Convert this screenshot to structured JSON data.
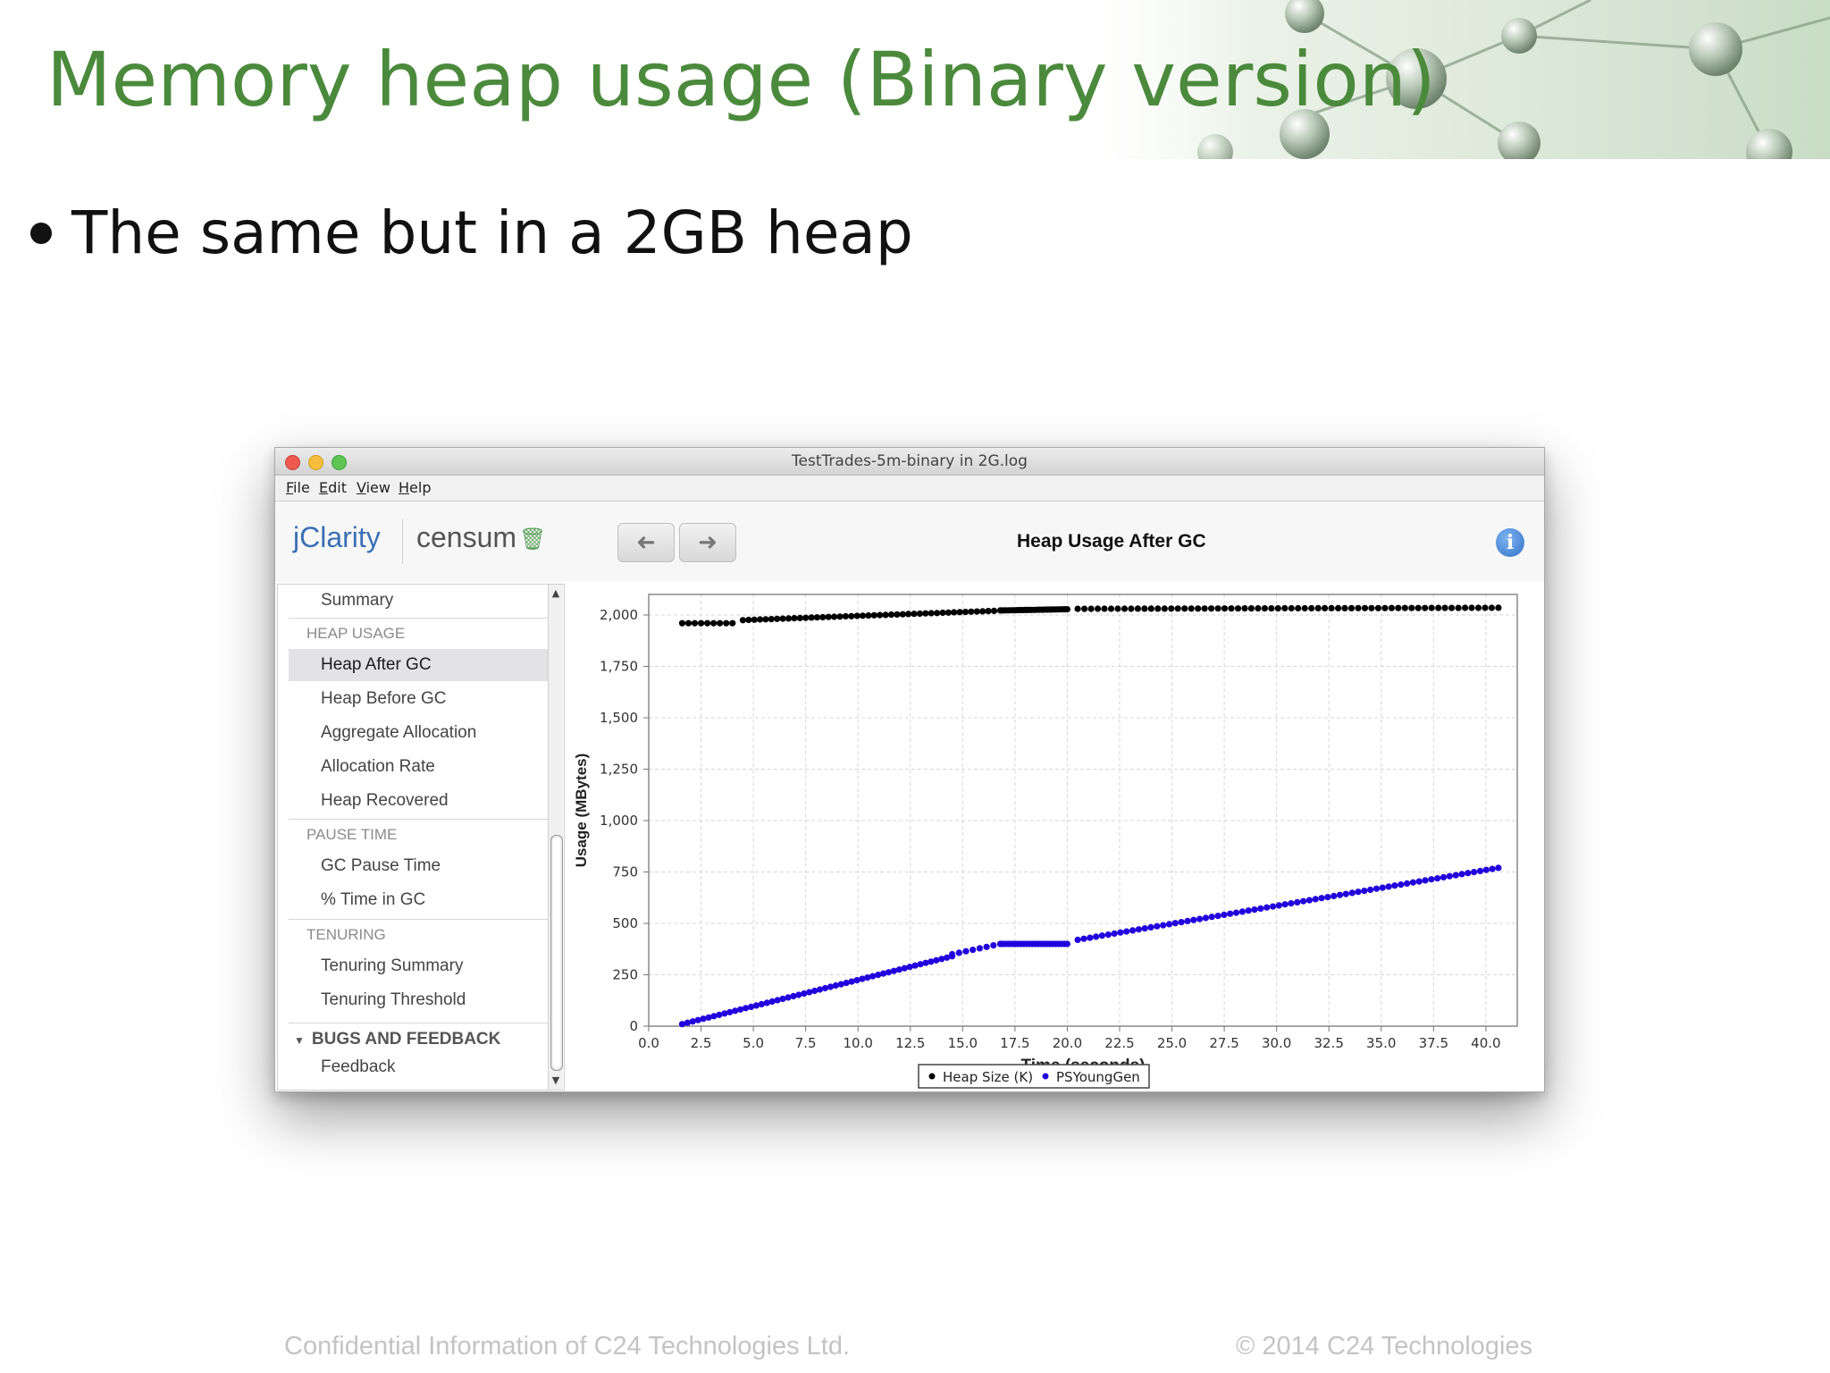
{
  "slide": {
    "title": "Memory heap usage (Binary version)",
    "bullet": "The same but in a 2GB heap",
    "footer_left": "Confidential Information of C24 Technologies Ltd.",
    "footer_right": "© 2014 C24 Technologies",
    "title_color": "#4b8a3c"
  },
  "window": {
    "title": "TestTrades-5m-binary in 2G.log",
    "menu": [
      {
        "u": "F",
        "rest": "ile"
      },
      {
        "u": "E",
        "rest": "dit"
      },
      {
        "u": "V",
        "rest": "iew"
      },
      {
        "u": "H",
        "rest": "elp"
      }
    ]
  },
  "toolbar": {
    "brand": "jClarity",
    "product": "censum",
    "back_icon": "arrow-left-icon",
    "forward_icon": "arrow-right-icon",
    "view_title": "Heap Usage After GC",
    "info_icon": "info-icon",
    "trash_icon": "trash-icon"
  },
  "sidebar": {
    "summary": "Summary",
    "heap_usage_header": "HEAP USAGE",
    "heap_usage_items": [
      "Heap After GC",
      "Heap Before GC",
      "Aggregate Allocation",
      "Allocation Rate",
      "Heap Recovered"
    ],
    "pause_time_header": "PAUSE TIME",
    "pause_time_items": [
      "GC Pause Time",
      "% Time in GC"
    ],
    "tenuring_header": "TENURING",
    "tenuring_items": [
      "Tenuring Summary",
      "Tenuring Threshold"
    ],
    "bugs_header": "BUGS AND FEEDBACK",
    "bugs_items": [
      "Feedback"
    ],
    "selected": "Heap After GC"
  },
  "chart_data": {
    "type": "scatter",
    "title": "",
    "xlabel": "Time (seconds)",
    "ylabel": "Usage (MBytes)",
    "xlim": [
      0,
      41.5
    ],
    "ylim": [
      0,
      2100
    ],
    "xticks": [
      "0.0",
      "2.5",
      "5.0",
      "7.5",
      "10.0",
      "12.5",
      "15.0",
      "17.5",
      "20.0",
      "22.5",
      "25.0",
      "27.5",
      "30.0",
      "32.5",
      "35.0",
      "37.5",
      "40.0"
    ],
    "yticks": [
      "0",
      "250",
      "500",
      "750",
      "1,000",
      "1,250",
      "1,500",
      "1,750",
      "2,000"
    ],
    "grid": true,
    "legend_position": "bottom-center",
    "series": [
      {
        "name": "Heap Size (K)",
        "color": "#000000",
        "segments": [
          {
            "x_start": 1.6,
            "x_end": 4.0,
            "count": 9,
            "y_start": 1960,
            "y_end": 1960
          },
          {
            "x_start": 4.5,
            "x_end": 16.5,
            "count": 45,
            "y_start": 1975,
            "y_end": 2020
          },
          {
            "x_start": 16.8,
            "x_end": 20.0,
            "count": 25,
            "y_start": 2022,
            "y_end": 2028
          },
          {
            "x_start": 20.5,
            "x_end": 40.6,
            "count": 64,
            "y_start": 2030,
            "y_end": 2035
          }
        ]
      },
      {
        "name": "PSYoungGen",
        "color": "#2200dd",
        "segments": [
          {
            "x_start": 1.6,
            "x_end": 14.5,
            "count": 52,
            "y_start": 10,
            "y_end": 340
          },
          {
            "x_start": 14.5,
            "x_end": 16.8,
            "count": 8,
            "y_start": 350,
            "y_end": 400
          },
          {
            "x_start": 16.8,
            "x_end": 20.0,
            "count": 24,
            "y_start": 400,
            "y_end": 400
          },
          {
            "x_start": 20.5,
            "x_end": 40.6,
            "count": 70,
            "y_start": 420,
            "y_end": 770
          }
        ]
      }
    ]
  }
}
